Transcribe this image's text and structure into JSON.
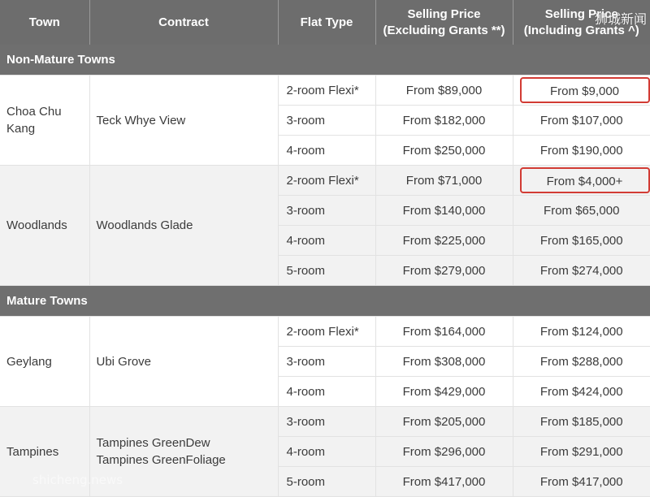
{
  "header": {
    "town": "Town",
    "contract": "Contract",
    "flat_type": "Flat Type",
    "price_excl_line1": "Selling Price",
    "price_excl_line2": "(Excluding Grants **)",
    "price_incl_line1": "Selling Price",
    "price_incl_line2": "(Including Grants ^)"
  },
  "sections": [
    {
      "title": "Non-Mature Towns",
      "groups": [
        {
          "town": "Choa Chu Kang",
          "contract": [
            "Teck Whye View"
          ],
          "rows": [
            {
              "flat_type": "2-room Flexi*",
              "price_excl": "From $89,000",
              "price_incl": "From $9,000",
              "highlight": true
            },
            {
              "flat_type": "3-room",
              "price_excl": "From $182,000",
              "price_incl": "From $107,000",
              "highlight": false
            },
            {
              "flat_type": "4-room",
              "price_excl": "From $250,000",
              "price_incl": "From $190,000",
              "highlight": false
            }
          ]
        },
        {
          "town": "Woodlands",
          "contract": [
            "Woodlands Glade"
          ],
          "rows": [
            {
              "flat_type": "2-room Flexi*",
              "price_excl": "From $71,000",
              "price_incl": "From $4,000+",
              "highlight": true
            },
            {
              "flat_type": "3-room",
              "price_excl": "From $140,000",
              "price_incl": "From $65,000",
              "highlight": false
            },
            {
              "flat_type": "4-room",
              "price_excl": "From $225,000",
              "price_incl": "From $165,000",
              "highlight": false
            },
            {
              "flat_type": "5-room",
              "price_excl": "From $279,000",
              "price_incl": "From $274,000",
              "highlight": false
            }
          ]
        }
      ]
    },
    {
      "title": "Mature Towns",
      "groups": [
        {
          "town": "Geylang",
          "contract": [
            "Ubi Grove"
          ],
          "rows": [
            {
              "flat_type": "2-room Flexi*",
              "price_excl": "From $164,000",
              "price_incl": "From $124,000",
              "highlight": false
            },
            {
              "flat_type": "3-room",
              "price_excl": "From $308,000",
              "price_incl": "From $288,000",
              "highlight": false
            },
            {
              "flat_type": "4-room",
              "price_excl": "From $429,000",
              "price_incl": "From $424,000",
              "highlight": false
            }
          ]
        },
        {
          "town": "Tampines",
          "contract": [
            "Tampines GreenDew",
            "Tampines GreenFoliage"
          ],
          "rows": [
            {
              "flat_type": "3-room",
              "price_excl": "From $205,000",
              "price_incl": "From $185,000",
              "highlight": false
            },
            {
              "flat_type": "4-room",
              "price_excl": "From $296,000",
              "price_incl": "From $291,000",
              "highlight": false
            },
            {
              "flat_type": "5-room",
              "price_excl": "From $417,000",
              "price_incl": "From $417,000",
              "highlight": false
            }
          ]
        }
      ]
    }
  ],
  "watermark": {
    "top": "狮城新闻",
    "bottom": "shicheng.news"
  },
  "colors": {
    "header_bg": "#6d6d6d",
    "section_bg": "#6f6f6f",
    "band_light": "#f2f2f2",
    "highlight_border": "#d23b34"
  }
}
